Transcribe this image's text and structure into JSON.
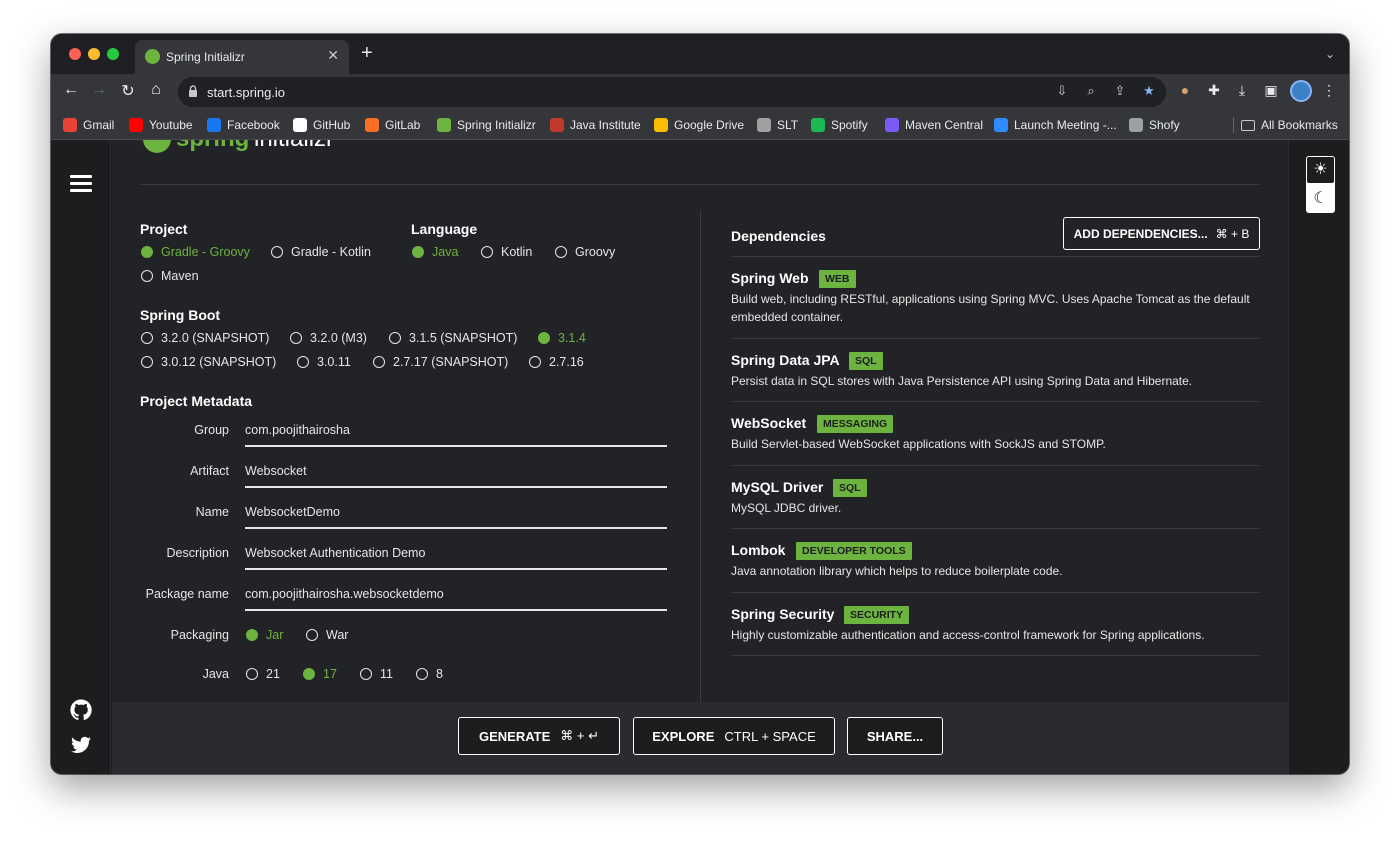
{
  "browser": {
    "tab_title": "Spring Initializr",
    "url": "start.spring.io",
    "new_tab": "+",
    "bookmarks": [
      {
        "label": "Gmail",
        "color": "#ea4335"
      },
      {
        "label": "Youtube",
        "color": "#ff0000"
      },
      {
        "label": "Facebook",
        "color": "#1877f2"
      },
      {
        "label": "GitHub",
        "color": "#ffffff"
      },
      {
        "label": "GitLab",
        "color": "#fc6d26"
      },
      {
        "label": "Spring Initializr",
        "color": "#6db33f"
      },
      {
        "label": "Java Institute",
        "color": "#c0392b"
      },
      {
        "label": "Google Drive",
        "color": "#fbbc04"
      },
      {
        "label": "SLT",
        "color": "#a0a0a0"
      },
      {
        "label": "Spotify",
        "color": "#1db954"
      },
      {
        "label": "Maven Central",
        "color": "#7a5af8"
      },
      {
        "label": "Launch Meeting -...",
        "color": "#2d8cff"
      },
      {
        "label": "Shofy",
        "color": "#9aa0a6"
      }
    ],
    "all_bookmarks": "All Bookmarks"
  },
  "page": {
    "logo_text": "spring initializr",
    "project": {
      "heading": "Project",
      "options": [
        "Gradle - Groovy",
        "Gradle - Kotlin",
        "Maven"
      ],
      "selected": "Gradle - Groovy"
    },
    "language": {
      "heading": "Language",
      "options": [
        "Java",
        "Kotlin",
        "Groovy"
      ],
      "selected": "Java"
    },
    "spring_boot": {
      "heading": "Spring Boot",
      "options": [
        "3.2.0 (SNAPSHOT)",
        "3.2.0 (M3)",
        "3.1.5 (SNAPSHOT)",
        "3.1.4",
        "3.0.12 (SNAPSHOT)",
        "3.0.11",
        "2.7.17 (SNAPSHOT)",
        "2.7.16"
      ],
      "selected": "3.1.4"
    },
    "metadata": {
      "heading": "Project Metadata",
      "fields": [
        {
          "label": "Group",
          "value": "com.poojithairosha"
        },
        {
          "label": "Artifact",
          "value": "Websocket"
        },
        {
          "label": "Name",
          "value": "WebsocketDemo"
        },
        {
          "label": "Description",
          "value": "Websocket Authentication Demo"
        },
        {
          "label": "Package name",
          "value": "com.poojithairosha.websocketdemo"
        }
      ],
      "packaging": {
        "label": "Packaging",
        "options": [
          "Jar",
          "War"
        ],
        "selected": "Jar"
      },
      "java": {
        "label": "Java",
        "options": [
          "21",
          "17",
          "11",
          "8"
        ],
        "selected": "17"
      }
    },
    "dependencies": {
      "heading": "Dependencies",
      "add_button": "ADD DEPENDENCIES...",
      "add_shortcut": "⌘ + B",
      "items": [
        {
          "name": "Spring Web",
          "badge": "WEB",
          "desc": "Build web, including RESTful, applications using Spring MVC. Uses Apache Tomcat as the default embedded container."
        },
        {
          "name": "Spring Data JPA",
          "badge": "SQL",
          "desc": "Persist data in SQL stores with Java Persistence API using Spring Data and Hibernate."
        },
        {
          "name": "WebSocket",
          "badge": "MESSAGING",
          "desc": "Build Servlet-based WebSocket applications with SockJS and STOMP."
        },
        {
          "name": "MySQL Driver",
          "badge": "SQL",
          "desc": "MySQL JDBC driver."
        },
        {
          "name": "Lombok",
          "badge": "DEVELOPER TOOLS",
          "desc": "Java annotation library which helps to reduce boilerplate code."
        },
        {
          "name": "Spring Security",
          "badge": "SECURITY",
          "desc": "Highly customizable authentication and access-control framework for Spring applications."
        }
      ]
    },
    "footer": {
      "generate": "GENERATE",
      "generate_shortcut": "⌘ + ↵",
      "explore": "EXPLORE",
      "explore_shortcut": "CTRL + SPACE",
      "share": "SHARE..."
    }
  },
  "colors": {
    "accent": "#6db33f",
    "bg": "#1c1d1f"
  }
}
